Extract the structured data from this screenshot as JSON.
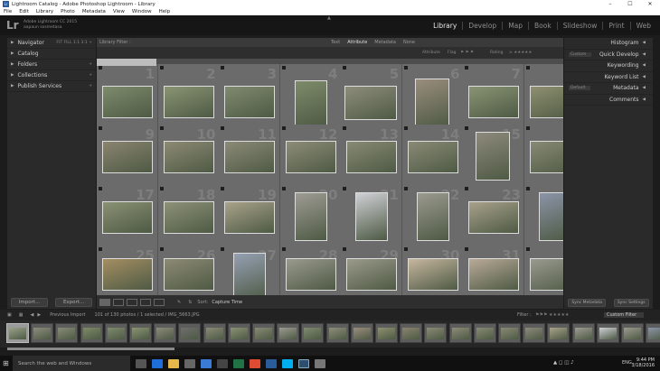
{
  "window": {
    "title": "Lightroom Catalog - Adobe Photoshop Lightroom - Library",
    "app_icon": "Lr",
    "controls": [
      "–",
      "☐",
      "✕"
    ]
  },
  "menu": [
    "File",
    "Edit",
    "Library",
    "Photo",
    "Metadata",
    "View",
    "Window",
    "Help"
  ],
  "identity": {
    "logo": "Lr",
    "line1": "Adobe Lightroom CC 2015",
    "line2": "aapaun sosmetasa"
  },
  "modules": [
    {
      "label": "Library",
      "active": true
    },
    {
      "label": "Develop",
      "active": false
    },
    {
      "label": "Map",
      "active": false
    },
    {
      "label": "Book",
      "active": false
    },
    {
      "label": "Slideshow",
      "active": false
    },
    {
      "label": "Print",
      "active": false
    },
    {
      "label": "Web",
      "active": false
    }
  ],
  "left_panel": {
    "sections": [
      {
        "label": "Navigator",
        "extra": "FIT  FILL  1:1  3:1 ÷"
      },
      {
        "label": "Catalog",
        "extra": ""
      },
      {
        "label": "Folders",
        "extra": "+"
      },
      {
        "label": "Collections",
        "extra": "+"
      },
      {
        "label": "Publish Services",
        "extra": "+"
      }
    ],
    "import_label": "Import...",
    "export_label": "Export..."
  },
  "filter_bar": {
    "label": "Library Filter :",
    "tabs": [
      {
        "label": "Text",
        "on": false
      },
      {
        "label": "Attribute",
        "on": true
      },
      {
        "label": "Metadata",
        "on": false
      },
      {
        "label": "None",
        "on": false
      }
    ],
    "attr_label": "Attribute",
    "flag_label": "Flag",
    "rating_label": "Rating"
  },
  "grid": {
    "numbers": [
      [
        "1",
        "2",
        "3",
        "4",
        "5",
        "6",
        "7",
        "8"
      ],
      [
        "9",
        "10",
        "11",
        "12",
        "13",
        "14",
        "15",
        "16"
      ],
      [
        "17",
        "18",
        "19",
        "20",
        "21",
        "22",
        "23",
        "24"
      ],
      [
        "25",
        "26",
        "27",
        "28",
        "29",
        "30",
        "31",
        "32"
      ]
    ]
  },
  "right_panel": {
    "sections": [
      {
        "label": "Histogram",
        "select": ""
      },
      {
        "label": "Quick Develop",
        "select": "Custom"
      },
      {
        "label": "Keywording",
        "select": ""
      },
      {
        "label": "Keyword List",
        "select": ""
      },
      {
        "label": "Metadata",
        "select": "Default"
      },
      {
        "label": "Comments",
        "select": ""
      }
    ],
    "sync_metadata": "Sync Metadata",
    "sync_settings": "Sync Settings"
  },
  "toolbar": {
    "sort_label": "Sort:",
    "sort_value": "Capture Time"
  },
  "film_bar": {
    "source": "Previous Import",
    "count": "101 of 130 photos / 1 selected / IMG_5663.JPG",
    "filter_label": "Filter :",
    "filter_value": "Custom Filter"
  },
  "taskbar": {
    "search_placeholder": "Search the web and Windows",
    "lang": "ENG",
    "time": "9:44 PM",
    "date": "3/18/2016"
  },
  "colors": {
    "accent_bg": "#1c1c1c",
    "grid_bg": "#4d4d4d",
    "active_module": "#e6e6e6"
  }
}
